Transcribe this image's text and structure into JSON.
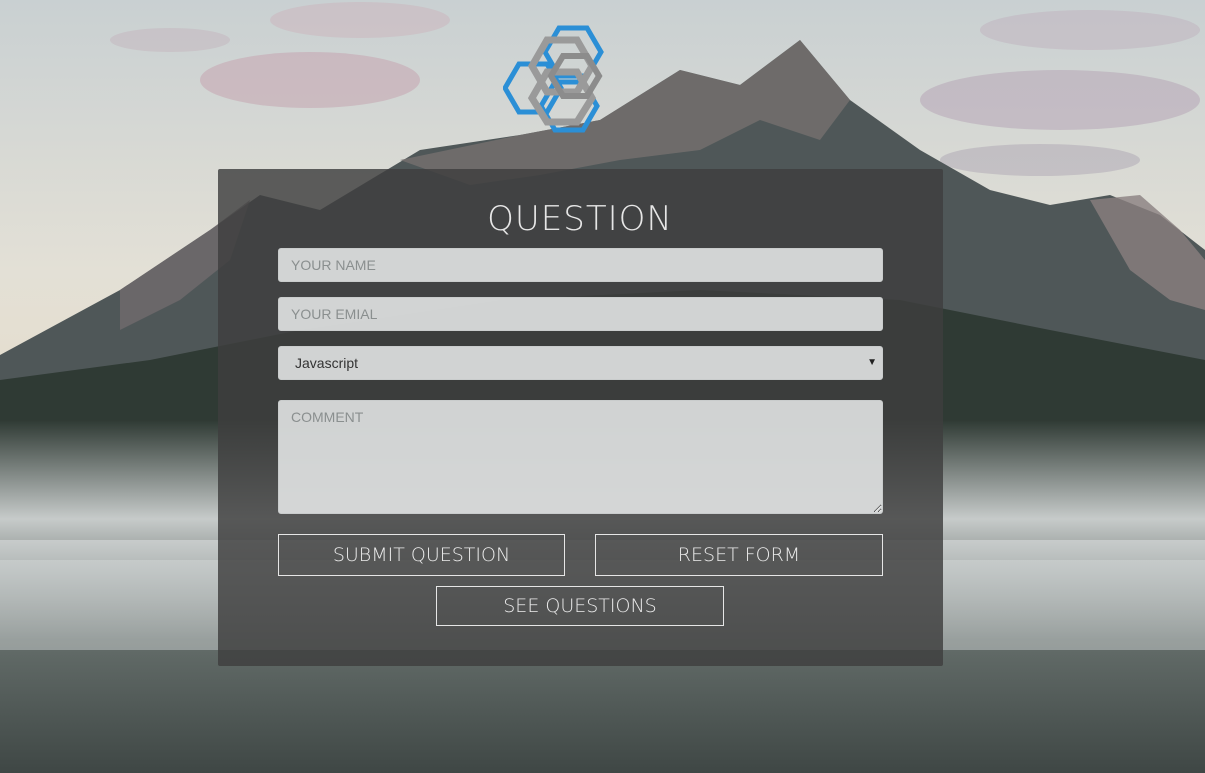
{
  "form": {
    "title": "QUESTION",
    "name_placeholder": "YOUR NAME",
    "email_placeholder": "YOUR EMIAL",
    "language_selected": "Javascript",
    "comment_placeholder": "COMMENT",
    "submit_label": "SUBMIT QUESTION",
    "reset_label": "RESET FORM",
    "see_label": "SEE QUESTIONS"
  },
  "icons": {
    "logo": "hexagon-logo-icon",
    "select_caret": "caret-down-icon"
  },
  "colors": {
    "logo_blue": "#2b8fd6",
    "logo_gray": "#9a9a9a",
    "panel": "#3e3e3e",
    "button_border": "#e6e6e6"
  }
}
